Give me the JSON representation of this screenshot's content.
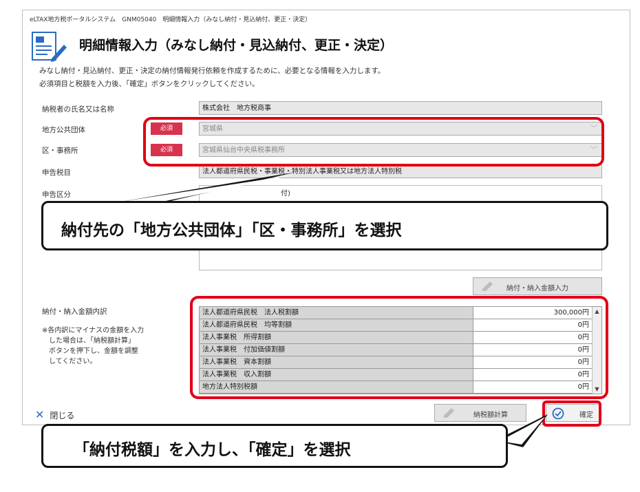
{
  "window": {
    "title": "eLTAX地方税ポータルシステム　GNM05040　明細情報入力（みなし納付・見込納付、更正・決定）",
    "heading": "明細情報入力（みなし納付・見込納付、更正・決定）"
  },
  "description": {
    "line1": "みなし納付・見込納付、更正・決定の納付情報発行依頼を作成するために、必要となる情報を入力します。",
    "line2": "必須項目と税額を入力後、「確定」ボタンをクリックしてください。"
  },
  "form": {
    "taxpayer_label": "納税者の氏名又は名称",
    "taxpayer_value": "株式会社　地方税商事",
    "local_gov_label": "地方公共団体",
    "local_gov_required": "必須",
    "local_gov_value": "宮城県",
    "office_label": "区・事務所",
    "office_required": "必須",
    "office_value": "宮城県仙台中央県税事務所",
    "tax_item_label": "申告税目",
    "tax_item_value": "法人都道府県民税・事業税・特別法人事業税又は地方法人特別税",
    "declaration_label": "申告区分",
    "declaration_value": "付)"
  },
  "payment": {
    "input_button": "納付・納入金額入力",
    "breakdown_label": "納付・納入金額内訳",
    "note_lines": [
      "※各内訳にマイナスの金額を入力",
      "　した場合は、「納税額計算」",
      "　ボタンを押下し、金額を調整",
      "　してください。"
    ],
    "rows": [
      {
        "name": "法人都道府県民税　法人税割額",
        "amount": "300,000円"
      },
      {
        "name": "法人都道府県民税　均等割額",
        "amount": "0円"
      },
      {
        "name": "法人事業税　所得割額",
        "amount": "0円"
      },
      {
        "name": "法人事業税　付加価値割額",
        "amount": "0円"
      },
      {
        "name": "法人事業税　資本割額",
        "amount": "0円"
      },
      {
        "name": "法人事業税　収入割額",
        "amount": "0円"
      },
      {
        "name": "地方法人特別税額",
        "amount": "0円"
      }
    ]
  },
  "footer": {
    "close_label": "閉じる",
    "calc_button": "納税額計算",
    "confirm_button": "確定"
  },
  "callouts": {
    "top": "納付先の「地方公共団体」「区・事務所」を選択",
    "bottom": "「納付税額」を入力し、「確定」を選択"
  },
  "colors": {
    "highlight": "#e00016",
    "required_badge": "#d8324f",
    "accent": "#2a6cc0"
  }
}
